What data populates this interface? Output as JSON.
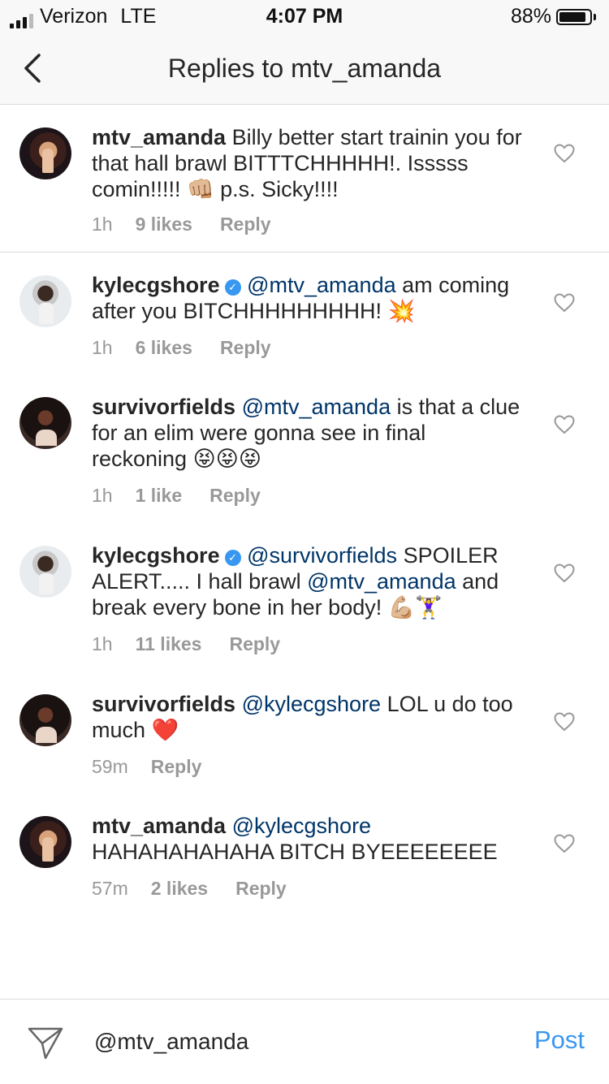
{
  "status_bar": {
    "carrier": "Verizon",
    "network": "LTE",
    "time": "4:07 PM",
    "battery": "88%",
    "battery_level": 0.88
  },
  "header": {
    "title": "Replies to mtv_amanda"
  },
  "comments": [
    {
      "username": "mtv_amanda",
      "verified": false,
      "mention": "",
      "text": " Billy better start trainin you for that hall brawl BITTTCHHHHH!. Isssss comin!!!!! 👊🏼 p.s. Sicky!!!!",
      "time": "1h",
      "likes": "9 likes",
      "reply": "Reply"
    },
    {
      "username": "kylecgshore",
      "verified": true,
      "mention": "@mtv_amanda",
      "text": " am coming after you BITCHHHHHHHHH! 💥",
      "time": "1h",
      "likes": "6 likes",
      "reply": "Reply"
    },
    {
      "username": "survivorfields",
      "verified": false,
      "mention": "@mtv_amanda",
      "text": " is that a clue for an elim were gonna see in final reckoning 😝😝😝",
      "time": "1h",
      "likes": "1 like",
      "reply": "Reply"
    },
    {
      "username": "kylecgshore",
      "verified": true,
      "mention": "@survivorfields",
      "text": " SPOILER ALERT..... I hall brawl ",
      "mention2": "@mtv_amanda",
      "text2": " and break every bone in her body! 💪🏼🏋️‍♀️",
      "time": "1h",
      "likes": "11 likes",
      "reply": "Reply"
    },
    {
      "username": "survivorfields",
      "verified": false,
      "mention": "@kylecgshore",
      "text": " LOL u do too much ❤️",
      "time": "59m",
      "likes": "",
      "reply": "Reply"
    },
    {
      "username": "mtv_amanda",
      "verified": false,
      "mention": "@kylecgshore",
      "text": " HAHAHAHAHAHA BITCH BYEEEEEEEE",
      "time": "57m",
      "likes": "2 likes",
      "reply": "Reply"
    }
  ],
  "composer": {
    "value": "@mtv_amanda",
    "post_label": "Post"
  },
  "colors": {
    "link": "#003569",
    "post": "#3897f0",
    "meta": "#999999",
    "verified": "#3897f0"
  }
}
